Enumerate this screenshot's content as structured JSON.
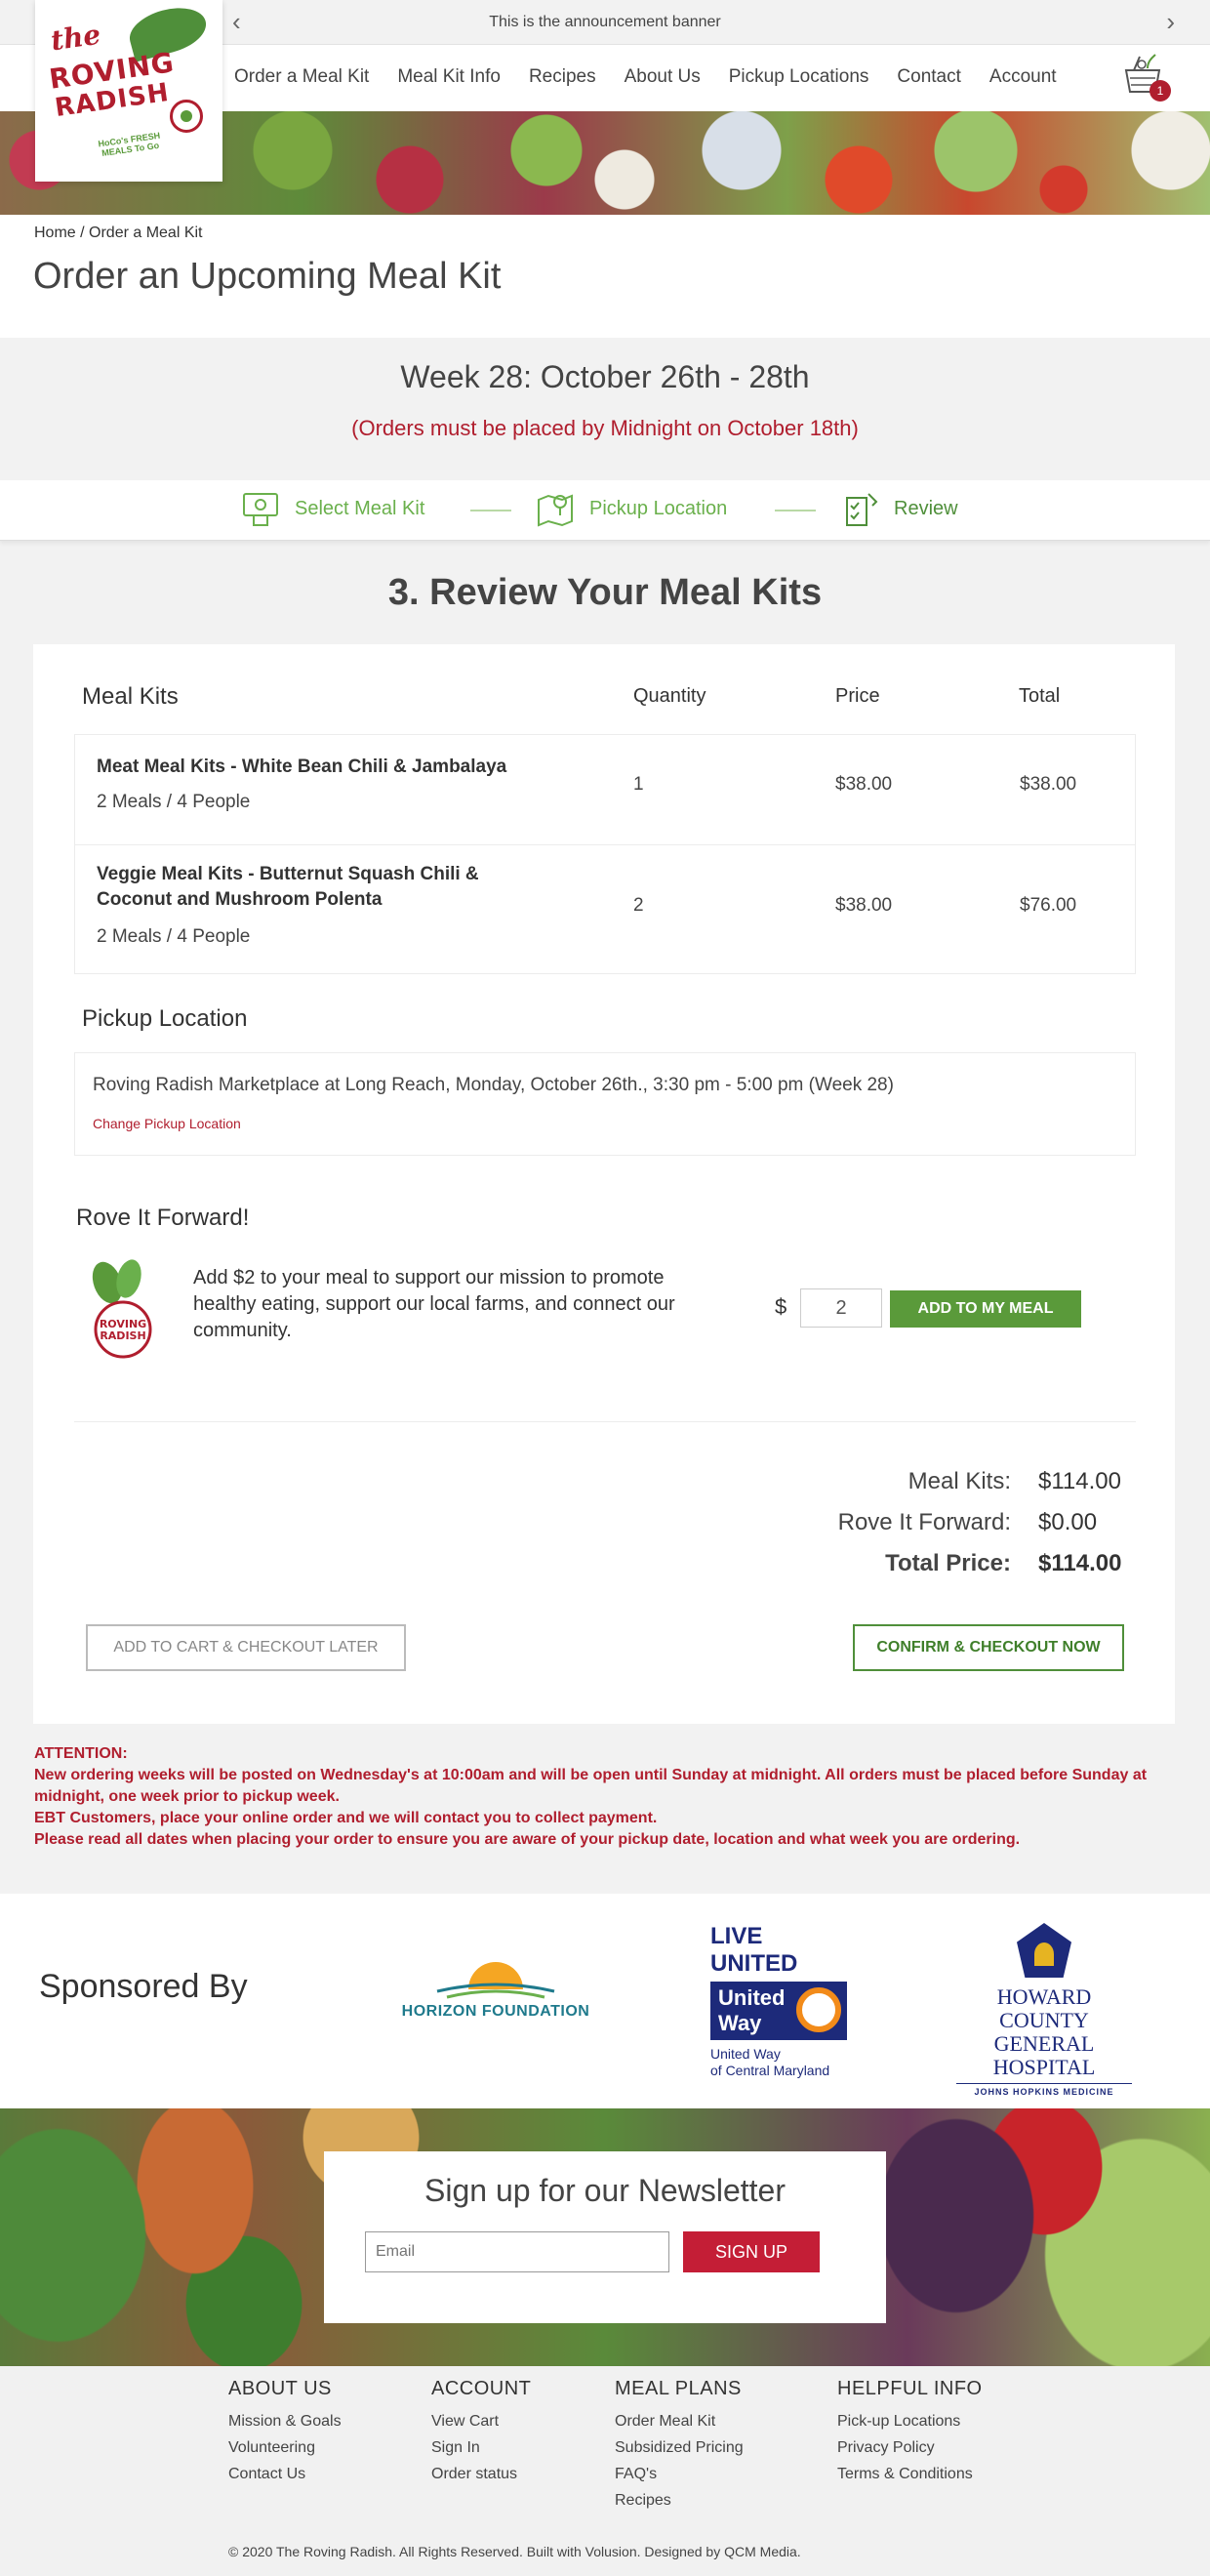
{
  "banner": {
    "text": "This is the announcement banner",
    "prev": "‹",
    "next": "›"
  },
  "logo": {
    "line1": "the",
    "line2": "ROVING",
    "line3": "RADISH",
    "tagline": "HoCo's FRESH MEALS To Go"
  },
  "nav": {
    "items": [
      "Order a Meal Kit",
      "Meal Kit Info",
      "Recipes",
      "About Us",
      "Pickup Locations",
      "Contact",
      "Account"
    ],
    "cart_count": "1"
  },
  "breadcrumb": "Home / Order a Meal Kit",
  "page_title": "Order an Upcoming Meal Kit",
  "week": {
    "title": "Week 28: October 26th - 28th",
    "deadline": "(Orders must be placed by Midnight on October 18th)"
  },
  "steps": [
    "Select Meal Kit",
    "Pickup Location",
    "Review"
  ],
  "review_title": "3. Review Your Meal Kits",
  "table": {
    "headers": {
      "meal_kits": "Meal Kits",
      "quantity": "Quantity",
      "price": "Price",
      "total": "Total"
    },
    "rows": [
      {
        "name": "Meat Meal Kits - White Bean Chili & Jambalaya",
        "meta": "2 Meals / 4 People",
        "qty": "1",
        "price": "$38.00",
        "total": "$38.00"
      },
      {
        "name": "Veggie Meal Kits - Butternut Squash Chili & Coconut and Mushroom Polenta",
        "meta": "2 Meals / 4 People",
        "qty": "2",
        "price": "$38.00",
        "total": "$76.00"
      }
    ]
  },
  "pickup": {
    "title": "Pickup Location",
    "location": "Roving Radish Marketplace at Long Reach, Monday, October 26th., 3:30 pm - 5:00 pm (Week 28)",
    "change_label": "Change Pickup Location"
  },
  "rove_forward": {
    "title": "Rove It Forward!",
    "description": "Add $2 to your meal to support our mission to promote healthy eating, support our local farms, and connect our community.",
    "currency": "$",
    "amount": "2",
    "button": "ADD TO MY MEAL"
  },
  "summary": {
    "meal_kits_label": "Meal Kits:",
    "meal_kits_value": "$114.00",
    "rif_label": "Rove It Forward:",
    "rif_value": "$0.00",
    "total_label": "Total Price:",
    "total_value": "$114.00"
  },
  "buttons": {
    "later": "ADD TO CART & CHECKOUT LATER",
    "confirm": "CONFIRM & CHECKOUT NOW"
  },
  "attention": [
    "ATTENTION:",
    "New ordering weeks will be posted on Wednesday's at 10:00am and will be open until Sunday at midnight. All orders must be placed before Sunday at midnight, one week prior to pickup week.",
    "EBT Customers, place your online order and we will contact you to collect payment.",
    "Please read all dates when placing your order to ensure you are aware of your pickup date, location and what week you are ordering."
  ],
  "sponsors": {
    "label": "Sponsored By",
    "horizon": "HORIZON FOUNDATION",
    "uw_live": "LIVE UNITED",
    "uw_name1": "United",
    "uw_name2": "Way",
    "uw_sub1": "United Way",
    "uw_sub2": "of Central Maryland",
    "hc1": "HOWARD COUNTY",
    "hc2": "GENERAL HOSPITAL",
    "hc3": "JOHNS HOPKINS MEDICINE"
  },
  "newsletter": {
    "title": "Sign up for our Newsletter",
    "email_placeholder": "Email",
    "button": "SIGN UP"
  },
  "footer": {
    "columns": [
      {
        "heading": "ABOUT US",
        "links": [
          "Mission & Goals",
          "Volunteering",
          "Contact Us"
        ]
      },
      {
        "heading": "ACCOUNT",
        "links": [
          "View Cart",
          "Sign In",
          "Order status"
        ]
      },
      {
        "heading": "MEAL PLANS",
        "links": [
          "Order Meal Kit",
          "Subsidized Pricing",
          "FAQ's",
          "Recipes"
        ]
      },
      {
        "heading": "HELPFUL INFO",
        "links": [
          "Pick-up Locations",
          "Privacy Policy",
          "Terms & Conditions"
        ]
      }
    ],
    "copyright": "© 2020 The Roving Radish. All Rights Reserved. Built with Volusion. Designed by QCM Media."
  },
  "colors": {
    "brand_red": "#b01e2e",
    "brand_green": "#5a9a3a",
    "step_green": "#6ab04c"
  }
}
